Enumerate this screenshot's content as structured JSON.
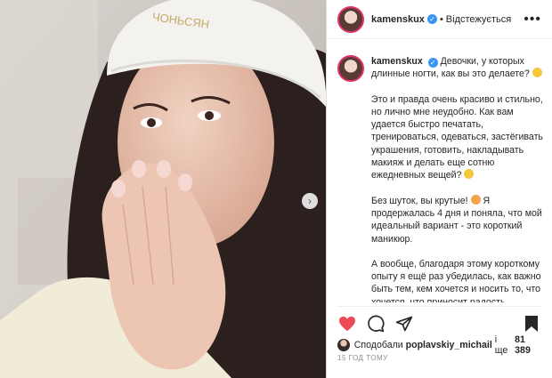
{
  "post": {
    "author": "kamenskux",
    "follow_status": "Відстежується",
    "more": "•••",
    "dot": "•",
    "verified": "✓",
    "hat_text": "ЧОНЬСЯН"
  },
  "caption": {
    "p1": "Девочки, у которых длинные ногти, как вы это делаете?",
    "p2": "Это и правда очень красиво и стильно, но лично мне неудобно. Как вам удается быстро печатать, тренироваться, одеваться, застёгивать украшения, готовить, накладывать макияж и делать еще сотню ежедневных вещей?",
    "p3": "Без шуток, вы крутые!",
    "p3b": "Я продержалась 4 дня и поняла, что мой идеальный вариант - это короткий маникюр.",
    "p4": "А вообще, благодаря этому короткому опыту я ещё раз убедилась, как важно быть тем, кем хочется и носить то, что хочется, что приносит радость."
  },
  "likes": {
    "prefix": "Сподобали",
    "user": "poplavskiy_michail",
    "connector": "і ще",
    "count": "81 389"
  },
  "time_ago": "15 ГОД ТОМУ",
  "icons": [
    "heart-icon",
    "comment-icon",
    "share-icon",
    "bookmark-icon",
    "next-icon"
  ],
  "colors": {
    "like": "#ed4956",
    "verified": "#3897f0",
    "text": "#262626",
    "muted": "#8e8e8e"
  }
}
